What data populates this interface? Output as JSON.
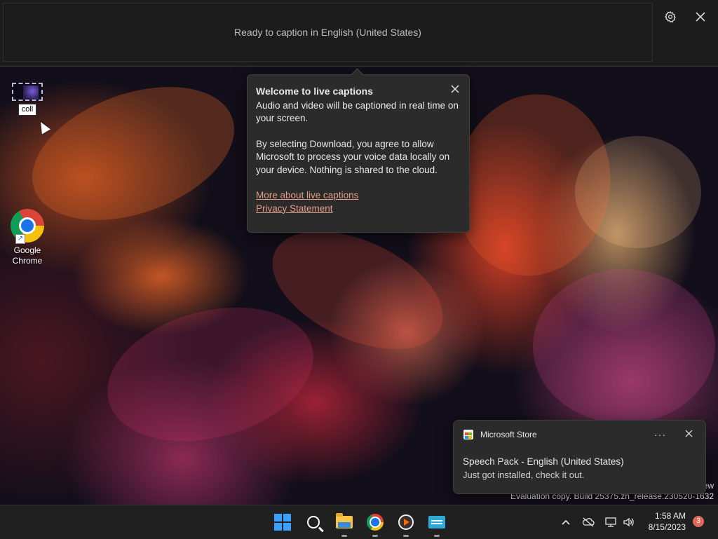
{
  "live_captions": {
    "status": "Ready to caption in English (United States)",
    "settings_icon": "gear-icon",
    "close_icon": "close-icon"
  },
  "welcome_flyout": {
    "title": "Welcome to live captions",
    "paragraph1": "Audio and video will be captioned in real time on your screen.",
    "paragraph2": "By selecting Download, you agree to allow Microsoft to process your voice data locally on your device. Nothing is shared to the cloud.",
    "link_more": "More about live captions",
    "link_privacy": "Privacy Statement"
  },
  "desktop": {
    "video_file": {
      "rename_value": "coll"
    },
    "chrome": {
      "label_line1": "Google",
      "label_line2": "Chrome"
    }
  },
  "watermark": {
    "line1": "ew",
    "line2": "Evaluation copy. Build 25375.zn_release.230520-1632"
  },
  "toast": {
    "app": "Microsoft Store",
    "more": "···",
    "title": "Speech Pack - English (United States)",
    "body": "Just got installed, check it out."
  },
  "taskbar": {
    "apps": [
      "start",
      "search",
      "file-explorer",
      "google-chrome",
      "media-player",
      "live-captions"
    ],
    "time": "1:58 AM",
    "date": "8/15/2023",
    "notification_count": "3"
  },
  "colors": {
    "link": "#e59c84",
    "accent": "#3aa0ff",
    "badge": "#e06a5a"
  }
}
